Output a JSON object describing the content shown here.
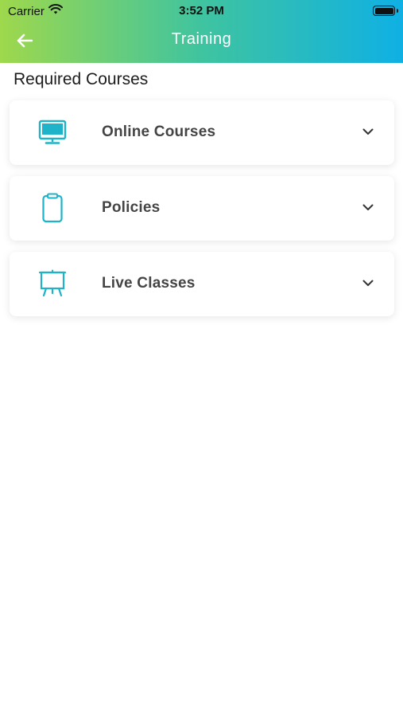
{
  "status_bar": {
    "carrier": "Carrier",
    "time": "3:52 PM",
    "wifi_icon": "wifi-icon",
    "battery_icon": "battery-icon"
  },
  "header": {
    "title": "Training",
    "back_icon": "arrow-left-icon",
    "gradient_start": "#9ed84c",
    "gradient_end": "#0fb0e4"
  },
  "section": {
    "title": "Required Courses"
  },
  "courses": [
    {
      "label": "Online Courses",
      "icon": "monitor-icon"
    },
    {
      "label": "Policies",
      "icon": "clipboard-icon"
    },
    {
      "label": "Live Classes",
      "icon": "easel-icon"
    }
  ],
  "colors": {
    "icon_accent": "#1fb3c9",
    "label_text": "#444444"
  }
}
